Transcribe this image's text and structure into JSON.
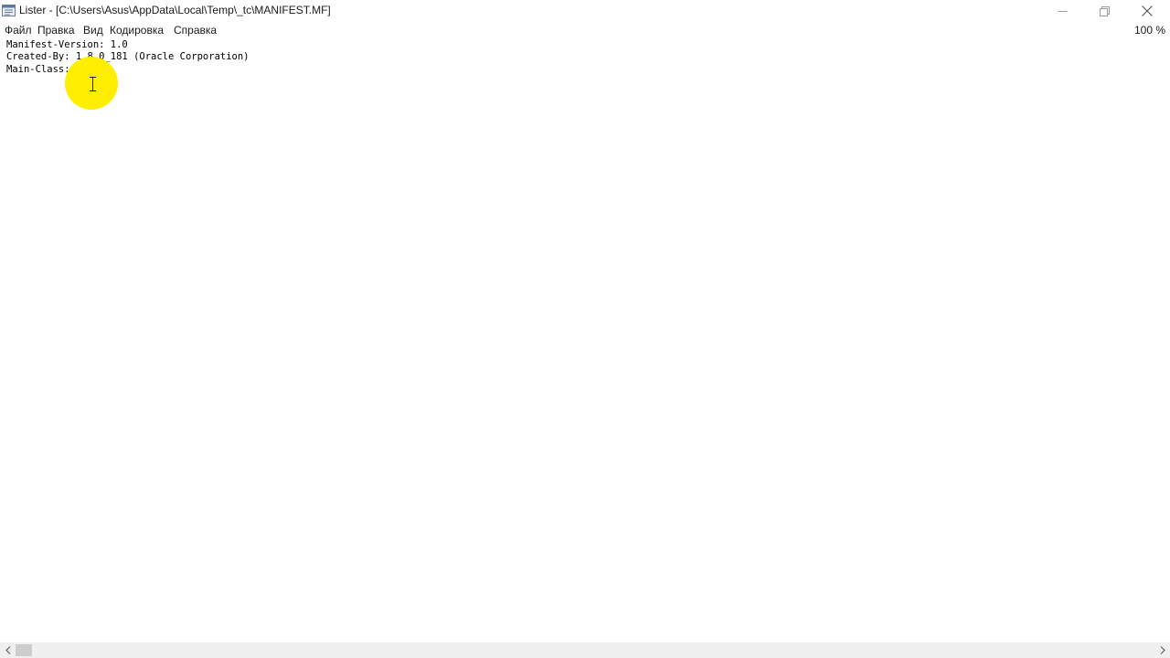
{
  "window": {
    "title": "Lister - [C:\\Users\\Asus\\AppData\\Local\\Temp\\_tc\\MANIFEST.MF]"
  },
  "menu": {
    "file": "Файл",
    "edit": "Правка",
    "view": "Вид",
    "encoding": "Кодировка",
    "help": "Справка",
    "zoom": "100 %"
  },
  "content": {
    "lines": [
      "Manifest-Version: 1.0",
      "Created-By: 1.8.0_181 (Oracle Corporation)",
      "Main-Class: Hi"
    ]
  },
  "icons": {
    "app": "lister-app-icon",
    "minimize": "minimize-icon",
    "maximize": "restore-icon",
    "close": "close-icon",
    "cursor": "text-cursor-icon",
    "scroll_left": "chevron-left-icon",
    "scroll_right": "chevron-right-icon"
  },
  "colors": {
    "cursor_highlight": "#ffee00",
    "background": "#ffffff",
    "scrollbar": "#f0f0f0"
  }
}
